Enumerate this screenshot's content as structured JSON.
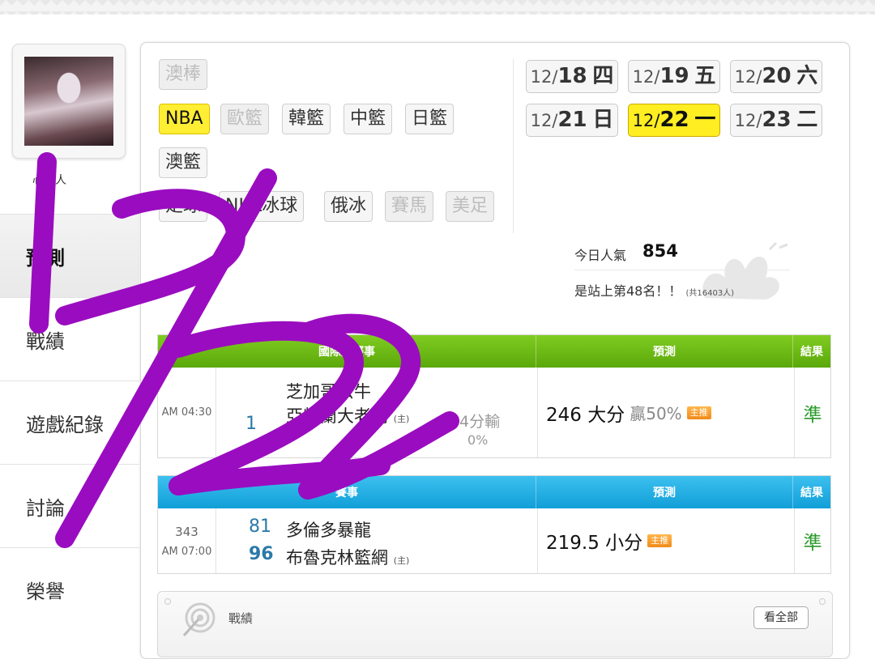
{
  "profile": {
    "username": "心的人"
  },
  "side_nav": [
    {
      "label": "預測",
      "active": true
    },
    {
      "label": "戰績",
      "active": false
    },
    {
      "label": "遊戲紀錄",
      "active": false
    },
    {
      "label": "討論",
      "active": false
    },
    {
      "label": "榮譽",
      "active": false
    }
  ],
  "sports": {
    "aus_baseball": "澳棒",
    "nba": "NBA",
    "euro_basketball": "歐籃",
    "korea_basketball": "韓籃",
    "china_basketball": "中籃",
    "japan_basketball": "日籃",
    "aus_basketball": "澳籃",
    "football": "足球",
    "nhl": "NHL冰球",
    "russia_ice": "俄冰",
    "horse_racing": "賽馬",
    "american_football": "美足"
  },
  "dates": [
    {
      "prefix": "12/",
      "day": "18",
      "weekday": "四",
      "active": false
    },
    {
      "prefix": "12/",
      "day": "19",
      "weekday": "五",
      "active": false
    },
    {
      "prefix": "12/",
      "day": "20",
      "weekday": "六",
      "active": false
    },
    {
      "prefix": "12/",
      "day": "21",
      "weekday": "日",
      "active": false
    },
    {
      "prefix": "12/",
      "day": "22",
      "weekday": "一",
      "active": true
    },
    {
      "prefix": "12/",
      "day": "23",
      "weekday": "二",
      "active": false
    }
  ],
  "popularity": {
    "label": "今日人氣",
    "count": "854",
    "rank_text": "是站上第48名！！",
    "total_text": "(共16403人)"
  },
  "table_headers": {
    "game1_title": "國際盤賽事",
    "game2_title": "賽事",
    "prediction": "預測",
    "result": "結果"
  },
  "games": [
    {
      "time": "AM 04:30",
      "away_team": "芝加哥公牛",
      "home_team": "亞特蘭大老鷹",
      "home_mark": "(主)",
      "score_home_fragment": "1",
      "handicap_note": "4分輸",
      "handicap_pct": "0%",
      "prediction": "246 大分",
      "win_rate": "贏50%",
      "badge": "主推",
      "result": "準"
    },
    {
      "number": "343",
      "time": "AM 07:00",
      "away_score": "81",
      "away_team": "多倫多暴龍",
      "home_score": "96",
      "home_team": "布魯克林籃網",
      "home_mark": "(主)",
      "prediction": "219.5 小分",
      "badge": "主推",
      "result": "準"
    }
  ],
  "record_card": {
    "title": "戰績",
    "see_all": "看全部"
  },
  "colors": {
    "green_header": "#6cbb15",
    "blue_header": "#24b0e4",
    "active_yellow": "#ffee22",
    "scribble": "#9a0cc0",
    "result_green": "#2a9a2a"
  }
}
